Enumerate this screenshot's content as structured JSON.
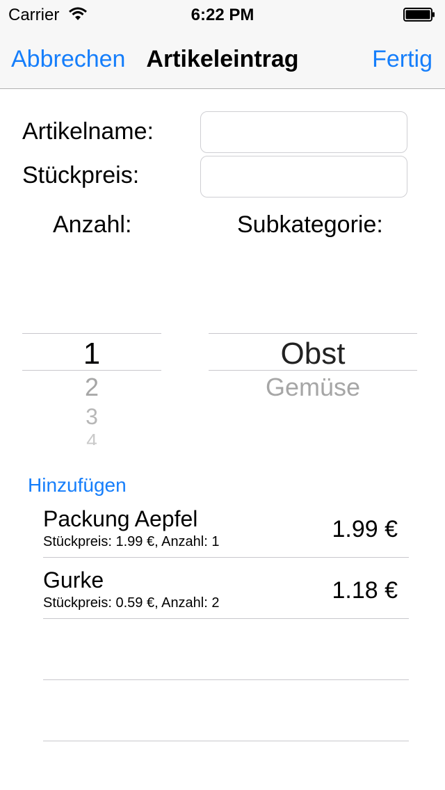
{
  "status_bar": {
    "carrier": "Carrier",
    "time": "6:22 PM"
  },
  "nav": {
    "cancel_label": "Abbrechen",
    "title": "Artikeleintrag",
    "done_label": "Fertig"
  },
  "form": {
    "name_label": "Artikelname:",
    "name_value": "",
    "price_label": "Stückpreis:",
    "price_value": "",
    "quantity_label": "Anzahl:",
    "subcategory_label": "Subkategorie:"
  },
  "quantity_picker": {
    "selected": "1",
    "options_below": [
      "2",
      "3",
      "4"
    ]
  },
  "subcategory_picker": {
    "selected": "Obst",
    "options_below": [
      "Gemüse"
    ]
  },
  "add_label": "Hinzufügen",
  "items": [
    {
      "name": "Packung Aepfel",
      "detail": "Stückpreis: 1.99 €, Anzahl: 1",
      "total": "1.99 €"
    },
    {
      "name": "Gurke",
      "detail": "Stückpreis: 0.59 €, Anzahl: 2",
      "total": "1.18 €"
    }
  ],
  "colors": {
    "accent": "#157efb",
    "separator": "#c8c7cc",
    "bar_bg": "#f7f7f7"
  }
}
